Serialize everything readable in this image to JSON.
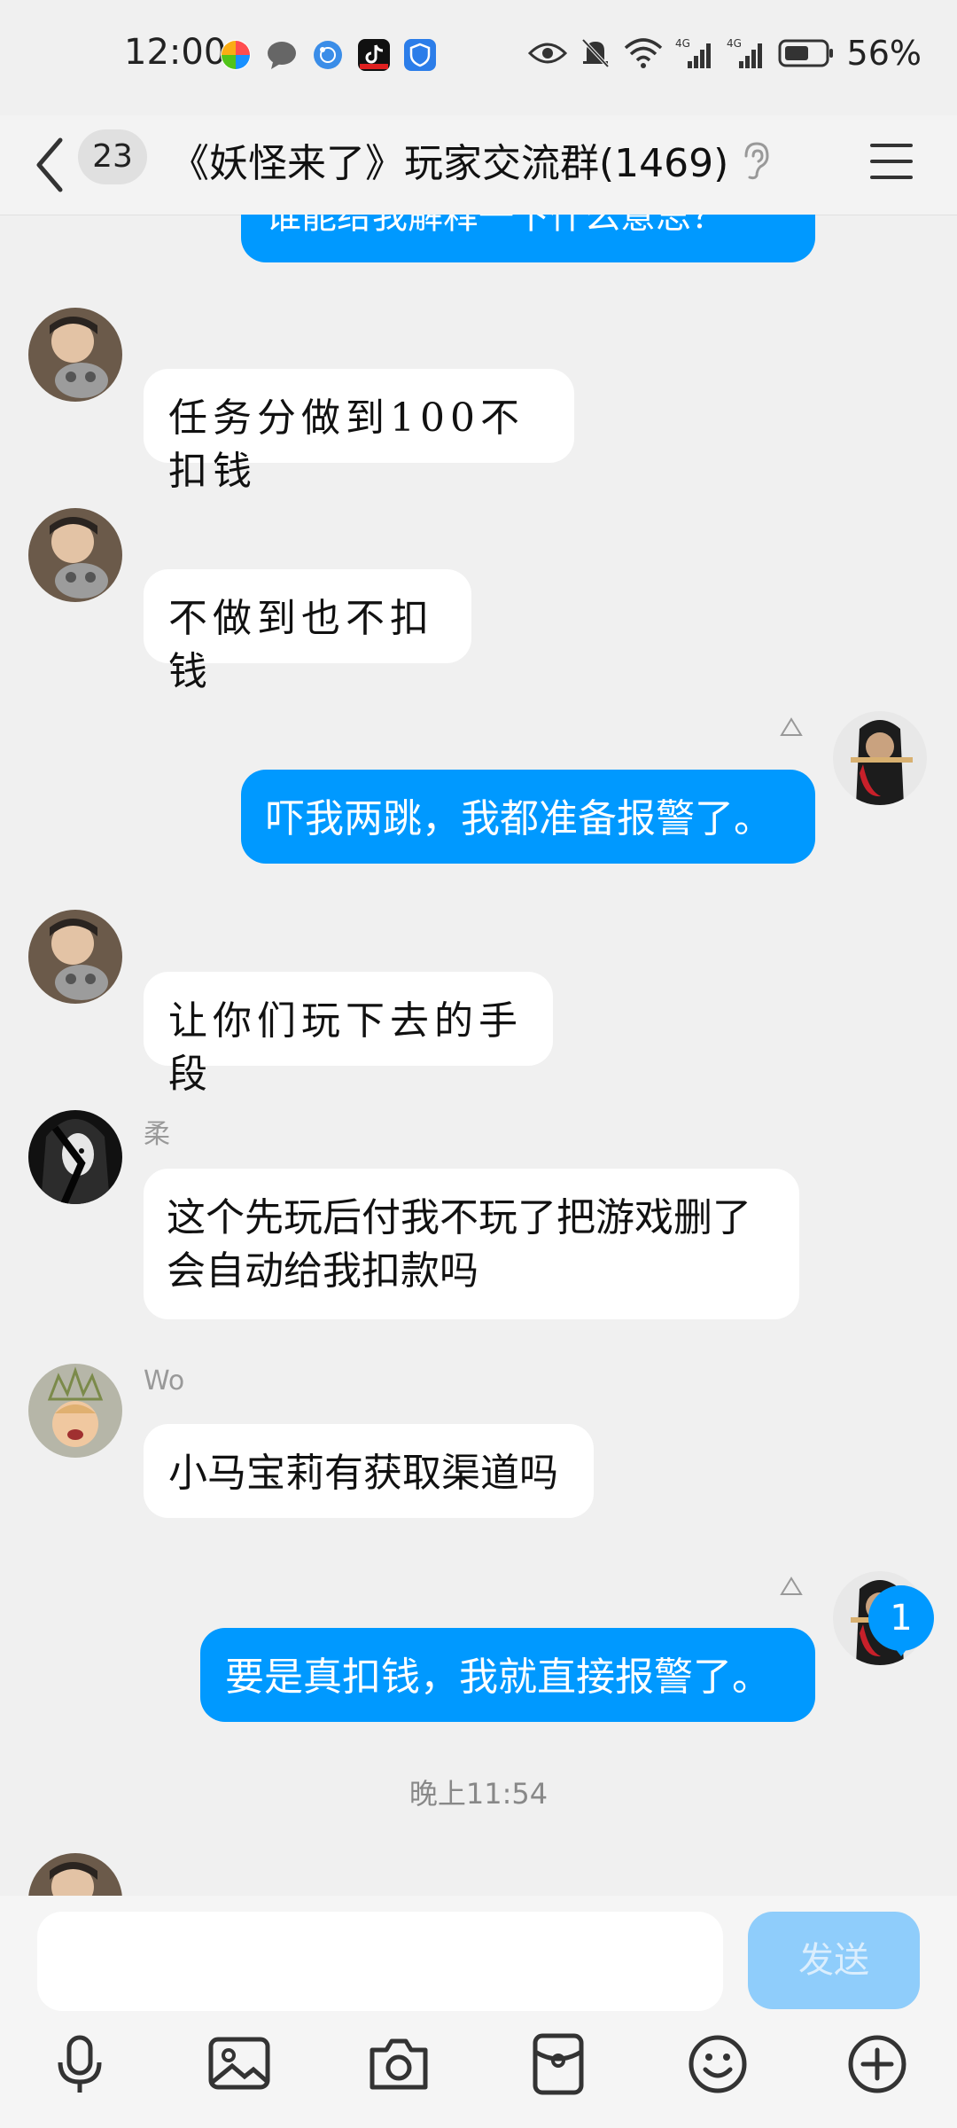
{
  "status_bar": {
    "time": "12:00",
    "battery": "56%",
    "network_1": "4G",
    "network_2": "4G"
  },
  "header": {
    "unread_count": "23",
    "title": "《妖怪来了》玩家交流群(1469)"
  },
  "messages": [
    {
      "side": "out",
      "text": "谁能给我解释一下什么意思？"
    },
    {
      "side": "in",
      "text": "任务分做到100不扣钱"
    },
    {
      "side": "in",
      "text": "不做到也不扣钱"
    },
    {
      "side": "out",
      "text": "吓我两跳，我都准备报警了。"
    },
    {
      "side": "in",
      "text": "让你们玩下去的手段"
    },
    {
      "side": "in",
      "sender": "柔",
      "text": "这个先玩后付我不玩了把游戏删了会自动给我扣款吗"
    },
    {
      "side": "in",
      "sender": "Wo",
      "text": "小马宝莉有获取渠道吗"
    },
    {
      "side": "out",
      "text": "要是真扣钱，我就直接报警了。"
    }
  ],
  "timestamp": "晚上11:54",
  "new_message_count": "1",
  "input": {
    "placeholder": "",
    "send_label": "发送"
  },
  "toolbar": [
    "microphone-icon",
    "image-icon",
    "camera-icon",
    "red-packet-icon",
    "emoji-icon",
    "plus-icon"
  ],
  "colors": {
    "accent": "#0099ff",
    "send_disabled": "#8fcdfb",
    "background": "#f0f0f0"
  }
}
